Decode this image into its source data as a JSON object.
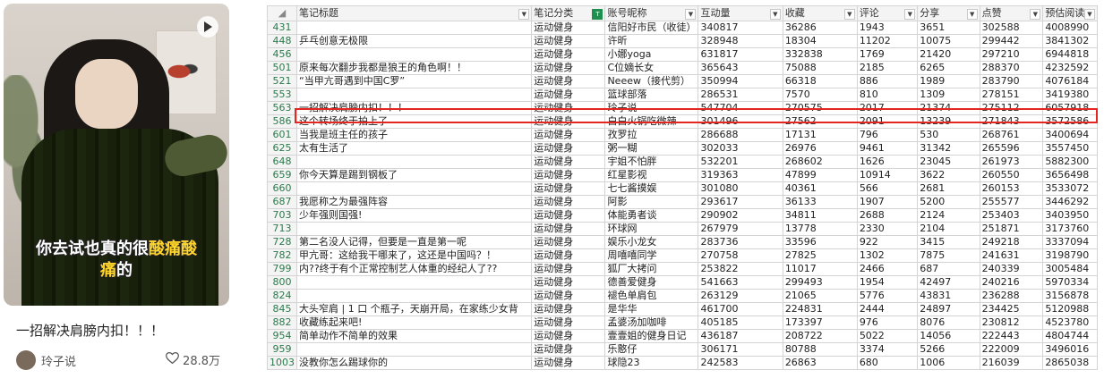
{
  "card": {
    "caption_line1_pre": "你去试也真的很",
    "caption_line1_hl": "酸痛酸",
    "caption_line2_hl": "痛",
    "caption_line2_post": "的",
    "title": "一招解决肩膀内扣！！！",
    "author": "玲子说",
    "likes": "28.8万"
  },
  "table": {
    "headers": [
      "笔记标题",
      "笔记分类",
      "账号昵称",
      "互动量",
      "收藏",
      "评论",
      "分享",
      "点赞",
      "预估阅读"
    ],
    "rows": [
      [
        "431",
        "",
        "运动健身",
        "信阳好市民（收徒）",
        "340817",
        "36286",
        "1943",
        "3651",
        "302588",
        "4008990"
      ],
      [
        "448",
        "乒乓创意无极限",
        "运动健身",
        "许昕",
        "328948",
        "18304",
        "11202",
        "10075",
        "299442",
        "3841302"
      ],
      [
        "456",
        "",
        "运动健身",
        "小娜yoga",
        "631817",
        "332838",
        "1769",
        "21420",
        "297210",
        "6944818"
      ],
      [
        "501",
        "原来每次翻步我都是狼王的角色啊！！",
        "运动健身",
        "C位嫡长女",
        "365643",
        "75088",
        "2185",
        "6265",
        "288370",
        "4232592"
      ],
      [
        "521",
        "“当甲亢哥遇到中国C罗”",
        "运动健身",
        "Neeew（接代剪）",
        "350994",
        "66318",
        "886",
        "1989",
        "283790",
        "4076184"
      ],
      [
        "553",
        "",
        "运动健身",
        "篮球部落",
        "286531",
        "7570",
        "810",
        "1309",
        "278151",
        "3419380"
      ],
      [
        "563",
        "一招解决肩膀内扣！！！",
        "运动健身",
        "玲子说",
        "547704",
        "270575",
        "2017",
        "21374",
        "275112",
        "6057918"
      ],
      [
        "586",
        "这个转场终于拍上了",
        "运动健身",
        "白白火锅吃微辣",
        "301496",
        "27562",
        "2091",
        "13239",
        "271843",
        "3572586"
      ],
      [
        "601",
        "当我是班主任的孩子",
        "运动健身",
        "孜罗拉",
        "286688",
        "17131",
        "796",
        "530",
        "268761",
        "3400694"
      ],
      [
        "625",
        "太有生活了",
        "运动健身",
        "粥一糊",
        "302033",
        "26976",
        "9461",
        "31342",
        "265596",
        "3557450"
      ],
      [
        "648",
        "",
        "运动健身",
        "宇姐不怕胖",
        "532201",
        "268602",
        "1626",
        "23045",
        "261973",
        "5882300"
      ],
      [
        "659",
        "你今天算是踢到钢板了",
        "运动健身",
        "红星影视",
        "319363",
        "47899",
        "10914",
        "3622",
        "260550",
        "3656498"
      ],
      [
        "660",
        "",
        "运动健身",
        "七七酱摸娱",
        "301080",
        "40361",
        "566",
        "2681",
        "260153",
        "3533072"
      ],
      [
        "687",
        "我愿称之为最强阵容",
        "运动健身",
        "阿影",
        "293617",
        "36133",
        "1907",
        "5200",
        "255577",
        "3446292"
      ],
      [
        "703",
        "少年强则国强!",
        "运动健身",
        "体能勇者谈",
        "290902",
        "34811",
        "2688",
        "2124",
        "253403",
        "3403950"
      ],
      [
        "713",
        "",
        "运动健身",
        "环球网",
        "267979",
        "13778",
        "2330",
        "2104",
        "251871",
        "3173760"
      ],
      [
        "728",
        "第二名没人记得，但要是一直是第一呢",
        "运动健身",
        "娱乐小龙女",
        "283736",
        "33596",
        "922",
        "3415",
        "249218",
        "3337094"
      ],
      [
        "782",
        "甲亢哥：这给我干哪来了，这还是中国吗？！",
        "运动健身",
        "周嘻嘻同学",
        "270758",
        "27825",
        "1302",
        "7875",
        "241631",
        "3198790"
      ],
      [
        "799",
        "内??终于有个正常控制艺人体重的经纪人了??",
        "运动健身",
        "狐厂大拷问",
        "253822",
        "11017",
        "2466",
        "687",
        "240339",
        "3005484"
      ],
      [
        "800",
        "",
        "运动健身",
        "德善爱健身",
        "541663",
        "299493",
        "1954",
        "42497",
        "240216",
        "5970334"
      ],
      [
        "824",
        "",
        "运动健身",
        "褪色单肩包",
        "263129",
        "21065",
        "5776",
        "43831",
        "236288",
        "3156878"
      ],
      [
        "845",
        "大头窄肩 | 1 口 个瓶子，天崩开局，在家练少女背",
        "运动健身",
        "是华华",
        "461700",
        "224831",
        "2444",
        "24897",
        "234425",
        "5120988"
      ],
      [
        "882",
        "收藏练起来吧!",
        "运动健身",
        "孟婆汤加咖啡",
        "405185",
        "173397",
        "976",
        "8076",
        "230812",
        "4523780"
      ],
      [
        "954",
        "简单动作不简单的效果",
        "运动健身",
        "壹壹姐的健身日记",
        "436187",
        "208722",
        "5022",
        "14056",
        "222443",
        "4804744"
      ],
      [
        "959",
        "",
        "运动健身",
        "乐憨仔",
        "306171",
        "80788",
        "3374",
        "5266",
        "222009",
        "3496016"
      ],
      [
        "1003",
        "没教你怎么踢球你的",
        "运动健身",
        "球隐23",
        "242583",
        "26863",
        "680",
        "1006",
        "216039",
        "2865038"
      ]
    ]
  }
}
